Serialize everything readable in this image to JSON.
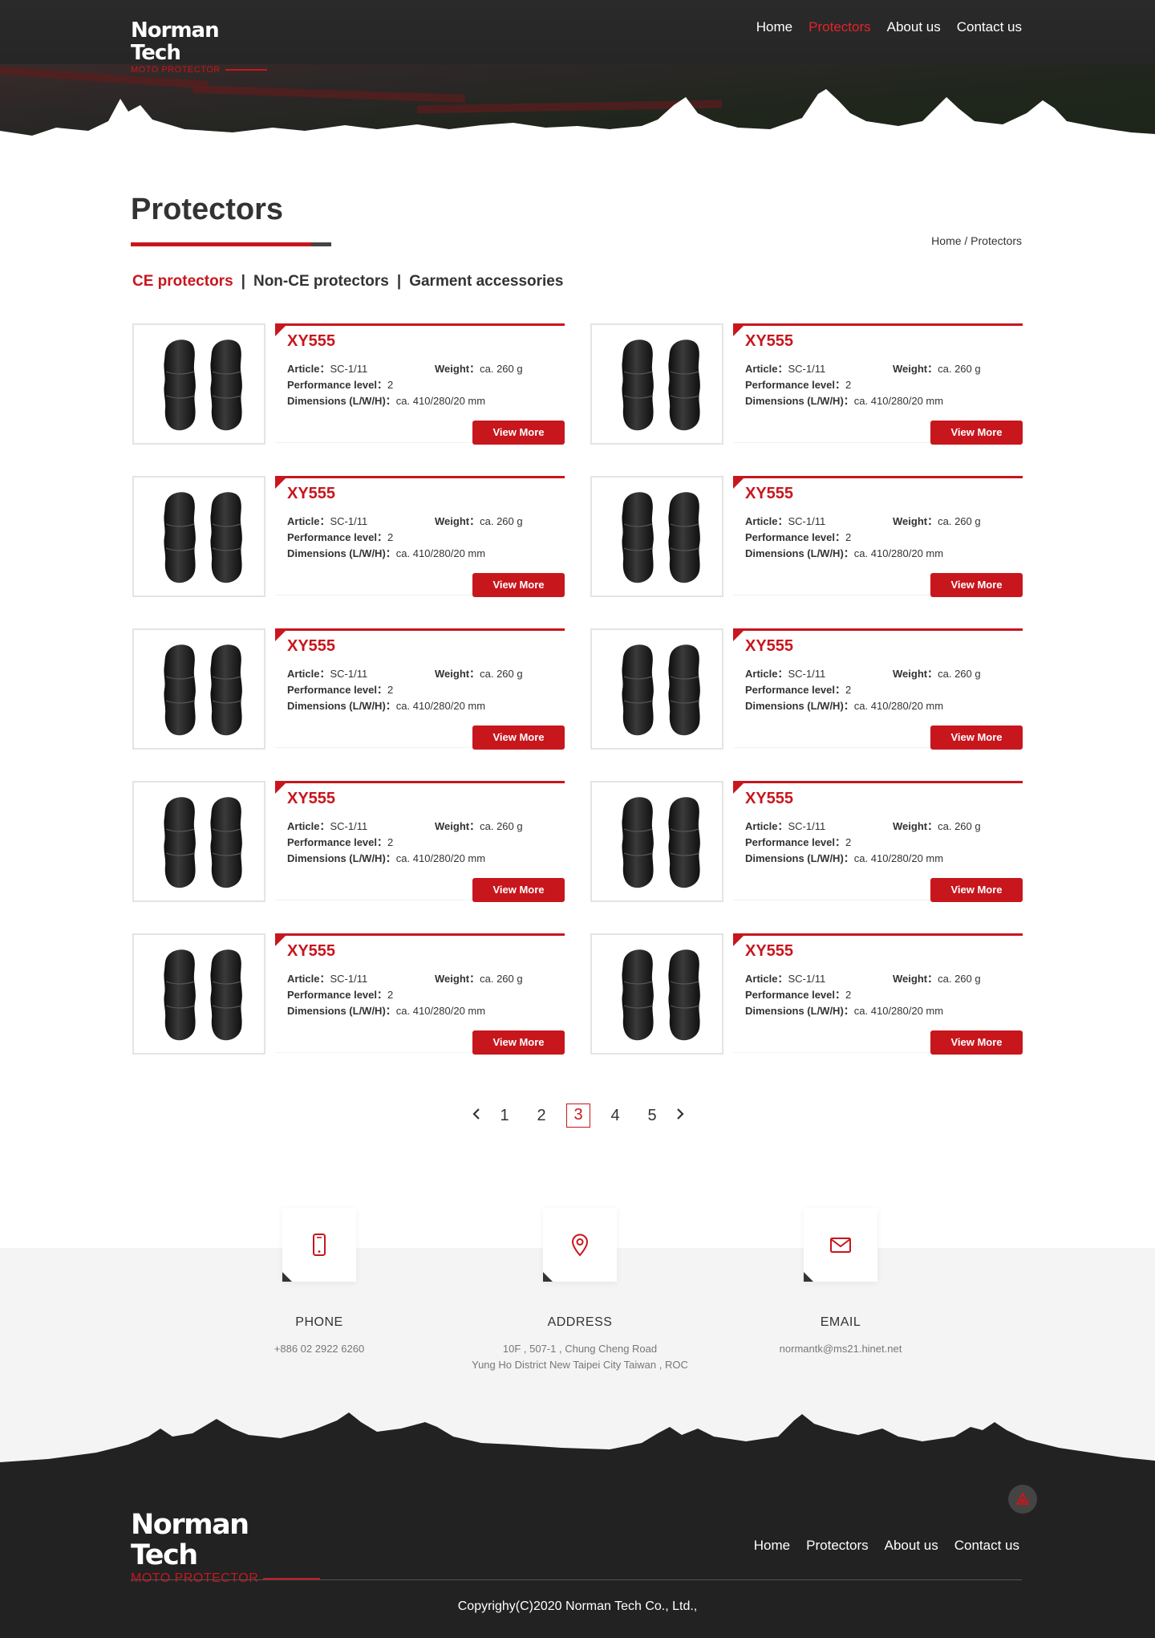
{
  "brand": {
    "name": "Norman Tech",
    "tagline": "MOTO PROTECTOR"
  },
  "nav": {
    "items": [
      {
        "label": "Home",
        "active": false
      },
      {
        "label": "Protectors",
        "active": true
      },
      {
        "label": "About us",
        "active": false
      },
      {
        "label": "Contact us",
        "active": false
      }
    ]
  },
  "page": {
    "title": "Protectors",
    "breadcrumb": "Home / Protectors"
  },
  "categories": [
    {
      "label": "CE protectors",
      "active": true
    },
    {
      "label": "Non-CE protectors",
      "active": false
    },
    {
      "label": "Garment accessories",
      "active": false
    }
  ],
  "category_separator": "|",
  "products": [
    {
      "name": "XY555",
      "article_label": "Article",
      "article": "SC-1/11",
      "weight_label": "Weight",
      "weight": "ca. 260 g",
      "level_label": "Performance level",
      "level": "2",
      "dims_label": "Dimensions (L/W/H)",
      "dims": "ca. 410/280/20 mm",
      "button": "View More"
    },
    {
      "name": "XY555",
      "article_label": "Article",
      "article": "SC-1/11",
      "weight_label": "Weight",
      "weight": "ca. 260 g",
      "level_label": "Performance level",
      "level": "2",
      "dims_label": "Dimensions (L/W/H)",
      "dims": "ca. 410/280/20 mm",
      "button": "View More"
    },
    {
      "name": "XY555",
      "article_label": "Article",
      "article": "SC-1/11",
      "weight_label": "Weight",
      "weight": "ca. 260 g",
      "level_label": "Performance level",
      "level": "2",
      "dims_label": "Dimensions (L/W/H)",
      "dims": "ca. 410/280/20 mm",
      "button": "View More"
    },
    {
      "name": "XY555",
      "article_label": "Article",
      "article": "SC-1/11",
      "weight_label": "Weight",
      "weight": "ca. 260 g",
      "level_label": "Performance level",
      "level": "2",
      "dims_label": "Dimensions (L/W/H)",
      "dims": "ca. 410/280/20 mm",
      "button": "View More"
    },
    {
      "name": "XY555",
      "article_label": "Article",
      "article": "SC-1/11",
      "weight_label": "Weight",
      "weight": "ca. 260 g",
      "level_label": "Performance level",
      "level": "2",
      "dims_label": "Dimensions (L/W/H)",
      "dims": "ca. 410/280/20 mm",
      "button": "View More"
    },
    {
      "name": "XY555",
      "article_label": "Article",
      "article": "SC-1/11",
      "weight_label": "Weight",
      "weight": "ca. 260 g",
      "level_label": "Performance level",
      "level": "2",
      "dims_label": "Dimensions (L/W/H)",
      "dims": "ca. 410/280/20 mm",
      "button": "View More"
    },
    {
      "name": "XY555",
      "article_label": "Article",
      "article": "SC-1/11",
      "weight_label": "Weight",
      "weight": "ca. 260 g",
      "level_label": "Performance level",
      "level": "2",
      "dims_label": "Dimensions (L/W/H)",
      "dims": "ca. 410/280/20 mm",
      "button": "View More"
    },
    {
      "name": "XY555",
      "article_label": "Article",
      "article": "SC-1/11",
      "weight_label": "Weight",
      "weight": "ca. 260 g",
      "level_label": "Performance level",
      "level": "2",
      "dims_label": "Dimensions (L/W/H)",
      "dims": "ca. 410/280/20 mm",
      "button": "View More"
    },
    {
      "name": "XY555",
      "article_label": "Article",
      "article": "SC-1/11",
      "weight_label": "Weight",
      "weight": "ca. 260 g",
      "level_label": "Performance level",
      "level": "2",
      "dims_label": "Dimensions (L/W/H)",
      "dims": "ca. 410/280/20 mm",
      "button": "View More"
    },
    {
      "name": "XY555",
      "article_label": "Article",
      "article": "SC-1/11",
      "weight_label": "Weight",
      "weight": "ca. 260 g",
      "level_label": "Performance level",
      "level": "2",
      "dims_label": "Dimensions (L/W/H)",
      "dims": "ca. 410/280/20 mm",
      "button": "View More"
    }
  ],
  "pagination": {
    "pages": [
      "1",
      "2",
      "3",
      "4",
      "5"
    ],
    "current": "3",
    "prev_icon": "chevron-left-icon",
    "next_icon": "chevron-right-icon"
  },
  "contact": [
    {
      "icon": "phone-icon",
      "label": "PHONE",
      "lines": [
        "+886 02 2922 6260"
      ]
    },
    {
      "icon": "map-pin-icon",
      "label": "ADDRESS",
      "lines": [
        "10F , 507-1 , Chung Cheng Road",
        "Yung Ho District New Taipei City Taiwan , ROC"
      ]
    },
    {
      "icon": "mail-icon",
      "label": "EMAIL",
      "lines": [
        "normantk@ms21.hinet.net"
      ]
    }
  ],
  "footer": {
    "nav": [
      "Home",
      "Protectors",
      "About us",
      "Contact us"
    ],
    "copyright": "Copyrighy(C)2020  Norman Tech Co., Ltd.,",
    "back_to_top_icon": "arrow-up-icon"
  },
  "colors": {
    "accent": "#c8161d",
    "dark": "#222222",
    "light_bg": "#f4f4f4"
  }
}
